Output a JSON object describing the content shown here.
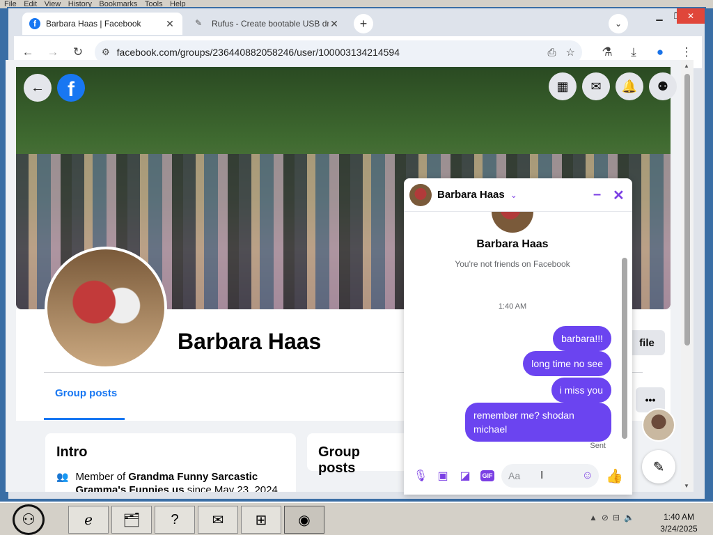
{
  "os_menu": {
    "items": [
      "File",
      "Edit",
      "View",
      "History",
      "Bookmarks",
      "Tools",
      "Help"
    ]
  },
  "browser": {
    "tabs": [
      {
        "title": "Barbara Haas | Facebook",
        "favicon": "facebook-icon",
        "active": true
      },
      {
        "title": "Rufus - Create bootable USB dr",
        "favicon": "usb-icon",
        "active": false
      }
    ],
    "url": "facebook.com/groups/236440882058246/user/100003134214594"
  },
  "facebook": {
    "logo": "f",
    "profile_name": "Barbara Haas",
    "profile_button_partial": "file",
    "more_button": "•••",
    "tab_label": "Group posts",
    "intro": {
      "title": "Intro",
      "member_prefix": "Member of ",
      "group_name": "Grandma Funny Sarcastic Gramma's Funnies us",
      "since_text": " since May 23, 2024"
    },
    "posts_card_title": "Group posts"
  },
  "messenger": {
    "contact_name": "Barbara Haas",
    "full_name": "Barbara Haas",
    "not_friends": "You're not friends on Facebook",
    "timestamp": "1:40 AM",
    "messages": [
      {
        "text": "barbara!!!"
      },
      {
        "text": "long time no see"
      },
      {
        "text": "i miss you"
      },
      {
        "text": "remember me? shodan michael"
      }
    ],
    "status": "Sent",
    "input_placeholder": "Aa",
    "accent_color": "#7b3fe4",
    "bubble_color": "#6b44f0"
  },
  "taskbar": {
    "apps": [
      "internet-explorer-icon",
      "file-manager-icon",
      "help-icon",
      "gmail-icon",
      "control-panel-icon",
      "chrome-icon"
    ],
    "clock_time": "1:40 AM",
    "clock_date": "3/24/2025"
  }
}
